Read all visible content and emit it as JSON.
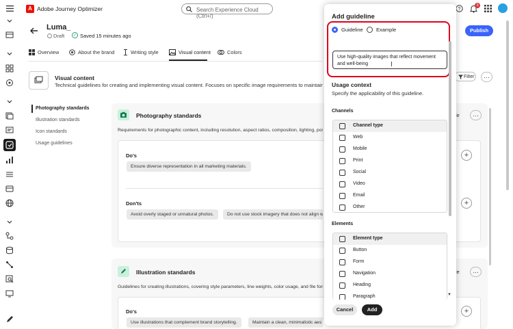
{
  "app": {
    "title": "Adobe Journey Optimizer",
    "logo_letter": "A"
  },
  "search": {
    "placeholder": "Search Experience Cloud (Ctrl+/)"
  },
  "notifications": {
    "count": "3"
  },
  "header": {
    "name": "Luma_",
    "status": "Draft",
    "saved": "Saved 15 minutes ago",
    "publish_label": "Publish"
  },
  "tabs": [
    {
      "label": "Overview"
    },
    {
      "label": "About the brand"
    },
    {
      "label": "Writing style"
    },
    {
      "label": "Visual content"
    },
    {
      "label": "Colors"
    }
  ],
  "section": {
    "title": "Visual content",
    "description": "Technical guidelines for creating and implementing visual content. Focuses on specific image requirements to maintain",
    "filter_label": "Filter"
  },
  "left_nav": [
    {
      "label": "Photography standards"
    },
    {
      "label": "Illustration standards"
    },
    {
      "label": "Icon standards"
    },
    {
      "label": "Usage guidelines"
    }
  ],
  "cards": [
    {
      "title": "Photography standards",
      "description": "Requirements for photographic content, including resolution, aspect ratios, composition, lighting, pos",
      "side_text": "le",
      "dos_label": "Do's",
      "dos": [
        "Ensure diverse representation in all marketing materials."
      ],
      "donts_label": "Don'ts",
      "donts": [
        "Avoid overly staged or unnatural photos.",
        "Do not use stock imagery that does not align w"
      ]
    },
    {
      "title": "Illustration standards",
      "description": "Guidelines for creating illustrations, covering style parameters, line weights, color usage, and file form",
      "side_text": "le",
      "dos_label": "Do's",
      "dos": [
        "Use illustrations that complement brand storytelling.",
        "Maintain a clean, minimalistic aes"
      ]
    }
  ],
  "panel": {
    "title": "Add guideline",
    "radio_guideline": "Guideline",
    "radio_example": "Example",
    "textarea_value": "Use high-quality images that reflect movement and well-being",
    "usage_title": "Usage context",
    "usage_desc": "Specify the applicability of this guideline.",
    "channels_label": "Channels",
    "channel_header": "Channel type",
    "channels": [
      "Web",
      "Mobile",
      "Print",
      "Social",
      "Video",
      "Email",
      "Other"
    ],
    "elements_label": "Elements",
    "element_header": "Element type",
    "elements": [
      "Button",
      "Form",
      "Navigation",
      "Heading",
      "Paragraph"
    ],
    "cancel_label": "Cancel",
    "add_label": "Add"
  }
}
